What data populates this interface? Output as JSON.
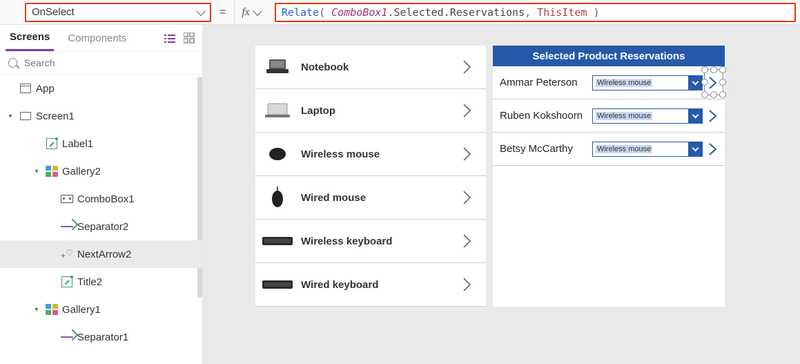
{
  "propertySelector": {
    "value": "OnSelect"
  },
  "formulaBar": {
    "fx": "fx",
    "tokens": [
      {
        "t": "fn",
        "v": "Relate"
      },
      {
        "t": "punct",
        "v": "( "
      },
      {
        "t": "id",
        "v": "ComboBox1"
      },
      {
        "t": "prop",
        "v": ".Selected.Reservations"
      },
      {
        "t": "punct",
        "v": ", "
      },
      {
        "t": "kw",
        "v": "ThisItem"
      },
      {
        "t": "punct",
        "v": " )"
      }
    ]
  },
  "treeTabs": {
    "screens": "Screens",
    "components": "Components"
  },
  "search": {
    "placeholder": "Search"
  },
  "tree": [
    {
      "label": "App",
      "icon": "app",
      "indent": 1,
      "twisty": ""
    },
    {
      "label": "Screen1",
      "icon": "screen",
      "indent": 1,
      "twisty": "▾"
    },
    {
      "label": "Label1",
      "icon": "label",
      "indent": 3,
      "twisty": ""
    },
    {
      "label": "Gallery2",
      "icon": "gallery",
      "indent": 3,
      "twisty": "▾"
    },
    {
      "label": "ComboBox1",
      "icon": "combo",
      "indent": 4,
      "twisty": ""
    },
    {
      "label": "Separator2",
      "icon": "sep",
      "indent": 4,
      "twisty": ""
    },
    {
      "label": "NextArrow2",
      "icon": "arrow",
      "indent": 4,
      "twisty": "",
      "selected": true
    },
    {
      "label": "Title2",
      "icon": "label",
      "indent": 4,
      "twisty": ""
    },
    {
      "label": "Gallery1",
      "icon": "gallery",
      "indent": 3,
      "twisty": "▾"
    },
    {
      "label": "Separator1",
      "icon": "sep",
      "indent": 4,
      "twisty": ""
    }
  ],
  "leftGallery": {
    "items": [
      {
        "label": "Notebook",
        "img": "laptop-open"
      },
      {
        "label": "Laptop",
        "img": "laptop-closed"
      },
      {
        "label": "Wireless mouse",
        "img": "mouse-round"
      },
      {
        "label": "Wired mouse",
        "img": "mouse-tall"
      },
      {
        "label": "Wireless keyboard",
        "img": "kbd"
      },
      {
        "label": "Wired keyboard",
        "img": "kbd"
      }
    ]
  },
  "rightPanel": {
    "header": "Selected Product Reservations",
    "rows": [
      {
        "name": "Ammar Peterson",
        "combo": "Wireless mouse",
        "selected": true
      },
      {
        "name": "Ruben Kokshoorn",
        "combo": "Wireless mouse"
      },
      {
        "name": "Betsy McCarthy",
        "combo": "Wireless mouse"
      }
    ]
  },
  "colors": {
    "accent": "#265aa8",
    "highlight": "#d83b01"
  }
}
